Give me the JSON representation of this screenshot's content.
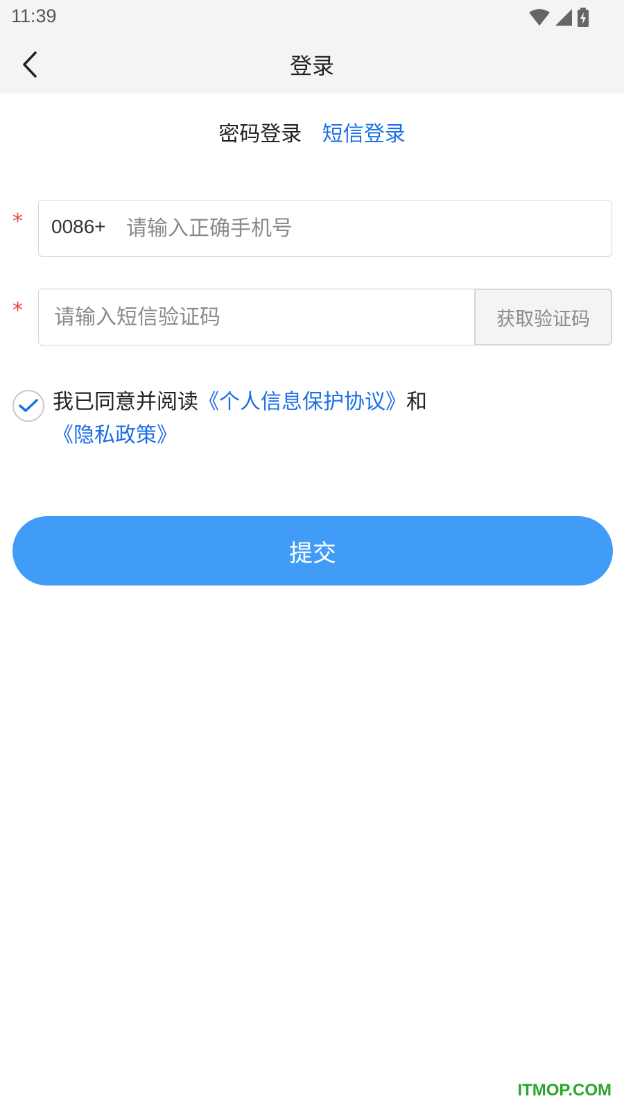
{
  "status_bar": {
    "time": "11:39",
    "icons": [
      "wifi-icon",
      "signal-icon",
      "battery-charging-icon"
    ]
  },
  "header": {
    "title": "登录",
    "back_icon": "chevron-left-icon"
  },
  "tabs": [
    {
      "label": "密码登录",
      "active": false
    },
    {
      "label": "短信登录",
      "active": true
    }
  ],
  "form": {
    "required_mark": "*",
    "phone": {
      "prefix": "0086+",
      "placeholder": "请输入正确手机号",
      "value": ""
    },
    "sms_code": {
      "placeholder": "请输入短信验证码",
      "value": "",
      "button_label": "获取验证码"
    }
  },
  "agreement": {
    "checked": true,
    "text_before": "我已同意并阅读",
    "link1": "《个人信息保护协议》",
    "text_between": "和",
    "link2": "《隐私政策》"
  },
  "submit_label": "提交",
  "watermark": "ITMOP.COM",
  "colors": {
    "accent": "#1c6fe5",
    "button": "#409cf7",
    "required": "#e04a3a"
  }
}
